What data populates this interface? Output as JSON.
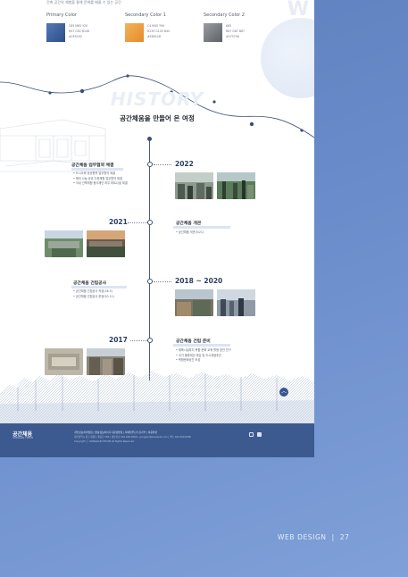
{
  "top_strip": {
    "text": "건축 공간의 체험을 통해 문화를 배울 수 있는 공간"
  },
  "colors": {
    "primary": "#3c5a8f",
    "accent": "#e99a3b",
    "gray": "#7a7f86",
    "background": "#6687c6"
  },
  "swatches": [
    {
      "title": "Primary Color",
      "cmyk": "C85 M65 Y20",
      "rgb": "R47 G92 B146",
      "hex": "#2E5C92",
      "color": "#36598f"
    },
    {
      "title": "Secondary Color 1",
      "cmyk": "C4 M45 Y90",
      "rgb": "R235 G145 B40",
      "hex": "#EB9128",
      "color": "#e99a3b"
    },
    {
      "title": "Secondary Color 2",
      "cmyk": "K65",
      "rgb": "R87 G87 B87",
      "hex": "#575758",
      "color": "#707377"
    }
  ],
  "history": {
    "ghost_title": "HISTORY",
    "title": "공간체움을 만들어 온 여정"
  },
  "timeline": [
    {
      "year": "2022",
      "heading": "공간체움 업무협약 체결",
      "bullets": [
        "드시오와 공공협력 업무협약 체결",
        "해외 나눔 공공 주문체험 업무협약 체결",
        "국내 건축체험 봉사재단 하우 파트너쉽 체결"
      ],
      "photos": [
        "photo-2022-1",
        "photo-2022-2"
      ]
    },
    {
      "year": "2021",
      "heading": "공간체움 개관",
      "bullets": [
        "공간체움 개관(5/21)"
      ],
      "photos": [
        "photo-2021-1",
        "photo-2021-2"
      ]
    },
    {
      "year": "2018 ~ 2020",
      "heading": "공간체움 건립공사",
      "bullets": [
        "공간체움 건립공사 착공(18.5)",
        "공간체움 건립공사 준공(20.11)"
      ],
      "photos": [
        "photo-2018-1",
        "photo-2018-2"
      ]
    },
    {
      "year": "2017",
      "heading": "공간체움 건립 준비",
      "bullets": [
        "체육시설부지 복합 문화 교육 활용 방안 연구",
        "국가 불용재산 매입 및 도시재생추진",
        "복합문화공간 조성"
      ],
      "photos": [
        "photo-2017-1",
        "photo-2017-2"
      ]
    }
  ],
  "footer": {
    "logo": "공간체움",
    "logo_sub": "GONGGAN CHEUM",
    "links": "개인정보처리방침 | 영상정보처리기기운영방침 | 이메일무단수집거부 | 이용약관",
    "info_1": "대전광역시 중구 대종로 체움로 000 | 대표번호 042-000-0000 | gonggan@example.com | 팩스 042-000-0000",
    "info_2": "Copyright ⓒ GONGGAN CHEUM All Rights Reserved.",
    "social": [
      "instagram-icon",
      "youtube-icon"
    ]
  },
  "caption": {
    "label": "WEB DESIGN",
    "separator": "|",
    "page": "27"
  }
}
